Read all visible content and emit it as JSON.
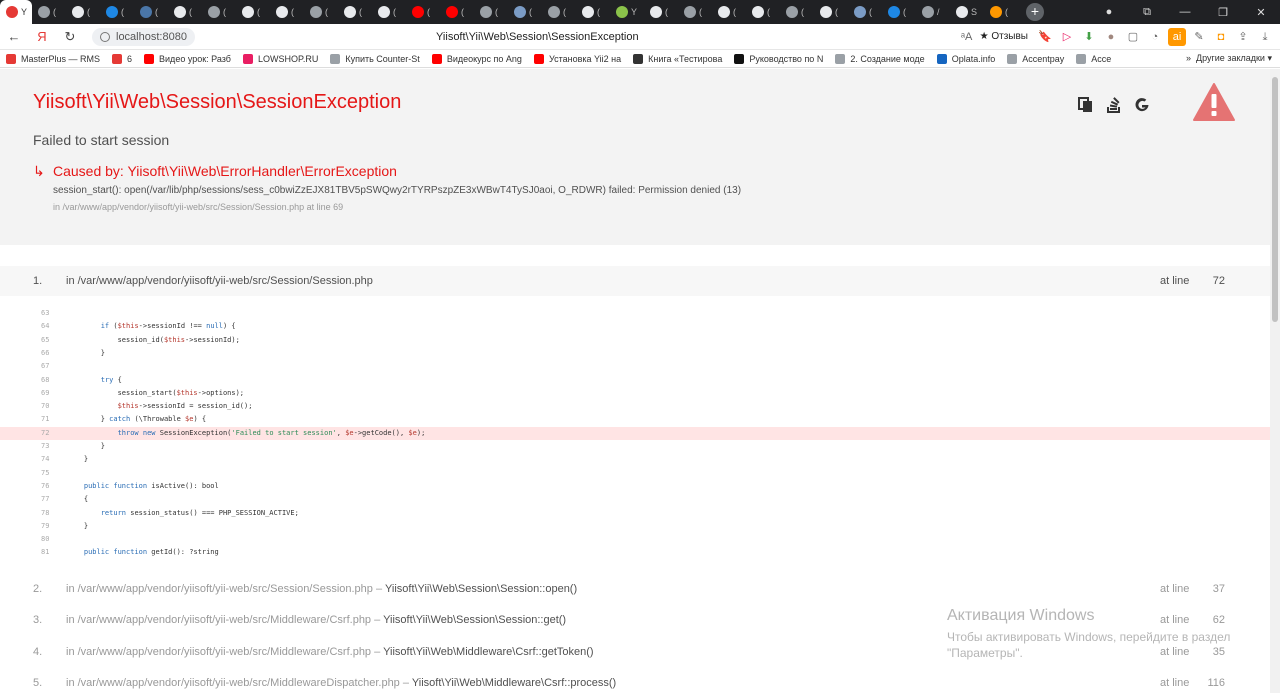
{
  "browser": {
    "tabs": [
      {
        "label": "Y",
        "color": "#e53935",
        "active": true
      },
      {
        "label": "(",
        "color": "#9aa0a6"
      },
      {
        "label": "(",
        "color": "#e8eaed"
      },
      {
        "label": "(",
        "color": "#1e88e5"
      },
      {
        "label": "(",
        "color": "#4a76a8"
      },
      {
        "label": "(",
        "color": "#e8eaed"
      },
      {
        "label": "(",
        "color": "#9aa0a6"
      },
      {
        "label": "(",
        "color": "#e8eaed"
      },
      {
        "label": "(",
        "color": "#e8eaed"
      },
      {
        "label": "(",
        "color": "#9aa0a6"
      },
      {
        "label": "(",
        "color": "#e8eaed"
      },
      {
        "label": "(",
        "color": "#e8eaed"
      },
      {
        "label": "(",
        "color": "#ff0000"
      },
      {
        "label": "(",
        "color": "#ff0000"
      },
      {
        "label": "(",
        "color": "#9aa0a6"
      },
      {
        "label": "(",
        "color": "#7b9cc6"
      },
      {
        "label": "(",
        "color": "#9aa0a6"
      },
      {
        "label": "(",
        "color": "#e8eaed"
      },
      {
        "label": "Y",
        "color": "#8bc34a"
      },
      {
        "label": "(",
        "color": "#e8eaed"
      },
      {
        "label": "(",
        "color": "#9aa0a6"
      },
      {
        "label": "(",
        "color": "#e8eaed"
      },
      {
        "label": "(",
        "color": "#e8eaed"
      },
      {
        "label": "(",
        "color": "#9aa0a6"
      },
      {
        "label": "(",
        "color": "#e8eaed"
      },
      {
        "label": "(",
        "color": "#7b9cc6"
      },
      {
        "label": "(",
        "color": "#1e88e5"
      },
      {
        "label": "/",
        "color": "#9aa0a6"
      },
      {
        "label": "S",
        "color": "#e8eaed"
      },
      {
        "label": "(",
        "color": "#ff9800"
      }
    ],
    "url": "localhost:8080",
    "page_title": "Yiisoft\\Yii\\Web\\Session\\SessionException",
    "reviews_label": "★ Отзывы",
    "bookmarks": [
      {
        "label": "MasterPlus — RMS",
        "color": "#e53935"
      },
      {
        "label": "6",
        "color": "#e53935"
      },
      {
        "label": "Видео урок: Разб",
        "color": "#ff0000"
      },
      {
        "label": "LOWSHOP.RU",
        "color": "#e91e63"
      },
      {
        "label": "Купить Counter-St",
        "color": "#9aa0a6"
      },
      {
        "label": "Видеокурс по Ang",
        "color": "#ff0000"
      },
      {
        "label": "Установка Yii2 на",
        "color": "#ff0000"
      },
      {
        "label": "Книга «Тестирова",
        "color": "#333333"
      },
      {
        "label": "Руководство по N",
        "color": "#111111"
      },
      {
        "label": "2. Создание моде",
        "color": "#9aa0a6"
      },
      {
        "label": "Oplata.info",
        "color": "#1565c0"
      },
      {
        "label": "Accentpay",
        "color": "#9aa0a6"
      },
      {
        "label": "Acce",
        "color": "#9aa0a6"
      }
    ],
    "other_bookmarks": "Другие закладки"
  },
  "error": {
    "title": "Yiisoft\\Yii\\Web\\Session\\SessionException",
    "message": "Failed to start session",
    "caused_by": "Caused by: Yiisoft\\Yii\\Web\\ErrorHandler\\ErrorException",
    "previous_message": "session_start(): open(/var/lib/php/sessions/sess_c0bwiZzEJX81TBV5pSWQwy2rTYRPszpZE3xWBwT4TySJ0aoi, O_RDWR) failed: Permission denied (13)",
    "previous_file": "in /var/www/app/vendor/yiisoft/yii-web/src/Session/Session.php at line 69"
  },
  "trace": {
    "at_line_label": "at line",
    "first": {
      "num": "1.",
      "file": "in /var/www/app/vendor/yiisoft/yii-web/src/Session/Session.php",
      "line": "72"
    },
    "code": [
      {
        "n": "63",
        "t": ""
      },
      {
        "n": "64",
        "t": "        if ($this->sessionId !== null) {"
      },
      {
        "n": "65",
        "t": "            session_id($this->sessionId);"
      },
      {
        "n": "66",
        "t": "        }"
      },
      {
        "n": "67",
        "t": ""
      },
      {
        "n": "68",
        "t": "        try {"
      },
      {
        "n": "69",
        "t": "            session_start($this->options);"
      },
      {
        "n": "70",
        "t": "            $this->sessionId = session_id();"
      },
      {
        "n": "71",
        "t": "        } catch (\\Throwable $e) {"
      },
      {
        "n": "72",
        "t": "            throw new SessionException('Failed to start session', $e->getCode(), $e);",
        "err": true
      },
      {
        "n": "73",
        "t": "        }"
      },
      {
        "n": "74",
        "t": "    }"
      },
      {
        "n": "75",
        "t": ""
      },
      {
        "n": "76",
        "t": "    public function isActive(): bool"
      },
      {
        "n": "77",
        "t": "    {"
      },
      {
        "n": "78",
        "t": "        return session_status() === PHP_SESSION_ACTIVE;"
      },
      {
        "n": "79",
        "t": "    }"
      },
      {
        "n": "80",
        "t": ""
      },
      {
        "n": "81",
        "t": "    public function getId(): ?string"
      }
    ],
    "rows": [
      {
        "num": "2.",
        "file": "in /var/www/app/vendor/yiisoft/yii-web/src/Session/Session.php",
        "fn": "Yiisoft\\Yii\\Web\\Session\\Session::open()",
        "line": "37"
      },
      {
        "num": "3.",
        "file": "in /var/www/app/vendor/yiisoft/yii-web/src/Middleware/Csrf.php",
        "fn": "Yiisoft\\Yii\\Web\\Session\\Session::get()",
        "line": "62"
      },
      {
        "num": "4.",
        "file": "in /var/www/app/vendor/yiisoft/yii-web/src/Middleware/Csrf.php",
        "fn": "Yiisoft\\Yii\\Web\\Middleware\\Csrf::getToken()",
        "line": "35"
      },
      {
        "num": "5.",
        "file": "in /var/www/app/vendor/yiisoft/yii-web/src/MiddlewareDispatcher.php",
        "fn": "Yiisoft\\Yii\\Web\\Middleware\\Csrf::process()",
        "line": "116"
      }
    ]
  },
  "activation": {
    "title": "Активация Windows",
    "line1": "Чтобы активировать Windows, перейдите в раздел",
    "line2": "\"Параметры\"."
  },
  "colors": {
    "accent": "#e51717",
    "warning": "#e57373",
    "error_line_bg": "#ffe4e4"
  }
}
